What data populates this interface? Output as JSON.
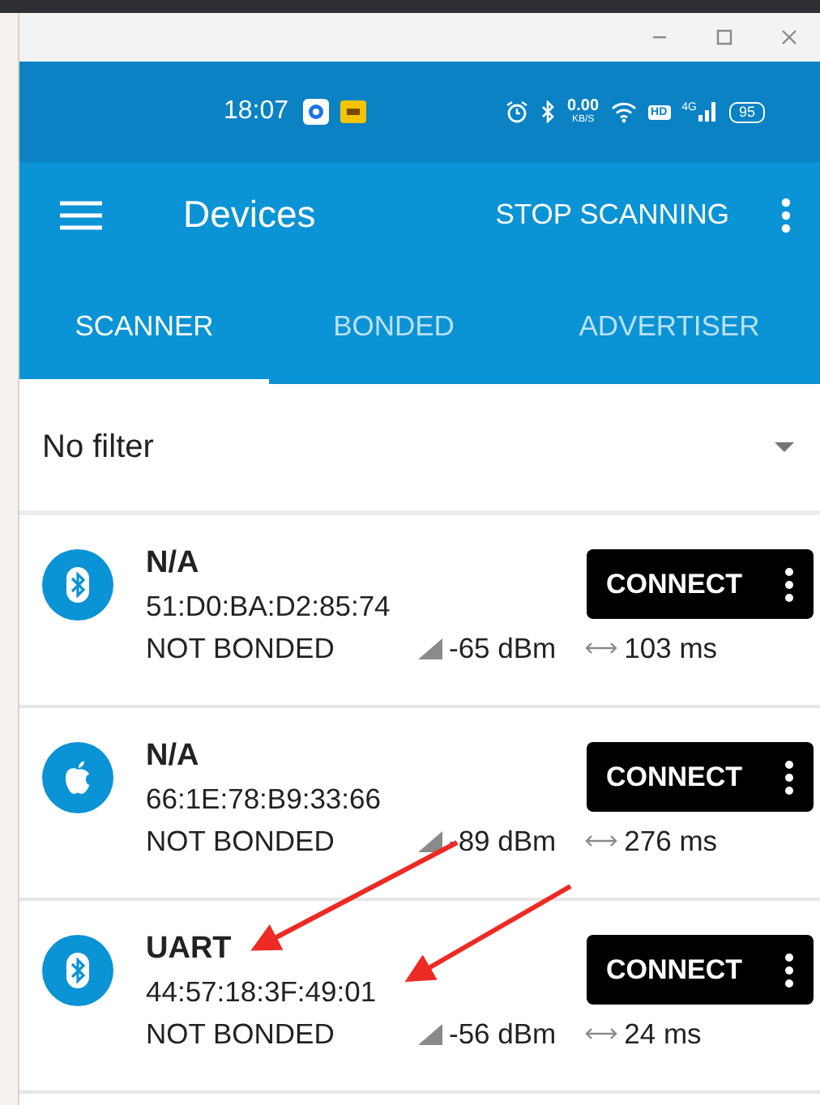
{
  "status_bar": {
    "time": "18:07",
    "speed": "0.00",
    "speed_unit": "KB/S",
    "hd": "HD",
    "network": "4G",
    "battery": "95"
  },
  "app_bar": {
    "title": "Devices",
    "action": "STOP SCANNING"
  },
  "tabs": [
    {
      "label": "SCANNER",
      "selected": true
    },
    {
      "label": "BONDED",
      "selected": false
    },
    {
      "label": "ADVERTISER",
      "selected": false
    }
  ],
  "filter": {
    "value": "No filter"
  },
  "devices": [
    {
      "kind": "bluetooth",
      "name": "N/A",
      "address": "51:D0:BA:D2:85:74",
      "bond": "NOT BONDED",
      "rssi": "-65 dBm",
      "interval": "103 ms",
      "button": "CONNECT"
    },
    {
      "kind": "apple",
      "name": "N/A",
      "address": "66:1E:78:B9:33:66",
      "bond": "NOT BONDED",
      "rssi": "-89 dBm",
      "interval": "276 ms",
      "button": "CONNECT"
    },
    {
      "kind": "bluetooth",
      "name": "UART",
      "address": "44:57:18:3F:49:01",
      "bond": "NOT BONDED",
      "rssi": "-56 dBm",
      "interval": "24 ms",
      "button": "CONNECT"
    }
  ],
  "annotations": [
    {
      "kind": "arrow"
    },
    {
      "kind": "arrow"
    }
  ]
}
